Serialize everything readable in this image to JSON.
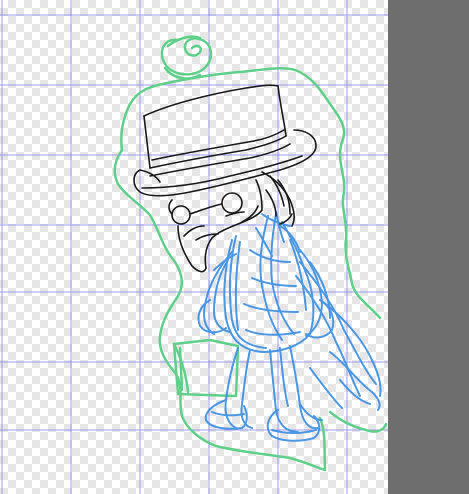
{
  "app": {
    "canvas_background": "transparent-checkerboard",
    "workspace_color": "#6e6e6e"
  },
  "grid": {
    "color": "#8c8cf0"
  },
  "layers": [
    {
      "name": "green-outline-sketch",
      "color": "#5fd08a"
    },
    {
      "name": "blue-rough-sketch",
      "color": "#3a8fe0"
    },
    {
      "name": "black-lineart",
      "color": "#1a1a1a"
    }
  ]
}
